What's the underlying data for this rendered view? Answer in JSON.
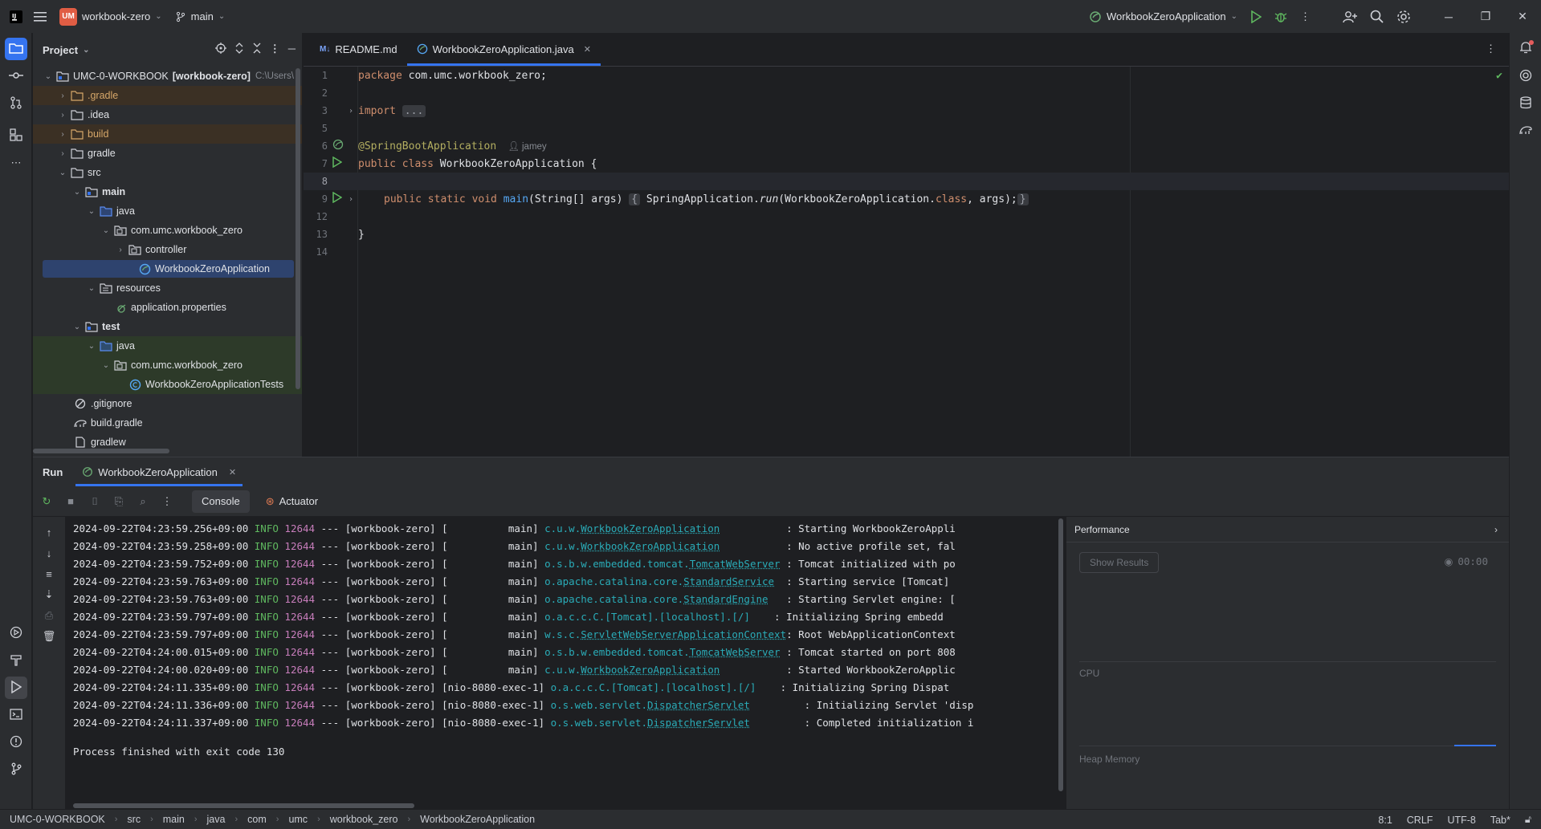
{
  "titlebar": {
    "project_badge": "UM",
    "project_name": "workbook-zero",
    "branch": "main",
    "run_config": "WorkbookZeroApplication"
  },
  "project_panel": {
    "title": "Project",
    "root_name": "UMC-0-WORKBOOK",
    "root_module": "[workbook-zero]",
    "root_path": "C:\\Users\\",
    "items": [
      {
        "label": ".gradle"
      },
      {
        "label": ".idea"
      },
      {
        "label": "build"
      },
      {
        "label": "gradle"
      },
      {
        "label": "src"
      },
      {
        "label": "main"
      },
      {
        "label": "java"
      },
      {
        "label": "com.umc.workbook_zero"
      },
      {
        "label": "controller"
      },
      {
        "label": "WorkbookZeroApplication"
      },
      {
        "label": "resources"
      },
      {
        "label": "application.properties"
      },
      {
        "label": "test"
      },
      {
        "label": "java"
      },
      {
        "label": "com.umc.workbook_zero"
      },
      {
        "label": "WorkbookZeroApplicationTests"
      },
      {
        "label": ".gitignore"
      },
      {
        "label": "build.gradle"
      },
      {
        "label": "gradlew"
      }
    ]
  },
  "editor": {
    "tabs": [
      {
        "label": "README.md",
        "badge": "M↓"
      },
      {
        "label": "WorkbookZeroApplication.java"
      }
    ],
    "line_numbers": [
      "1",
      "2",
      "3",
      "5",
      "6",
      "7",
      "8",
      "9",
      "12",
      "13",
      "14"
    ],
    "code": {
      "package_kw": "package",
      "package_name": " com.umc.workbook_zero;",
      "import_kw": "import",
      "import_fold": "...",
      "annotation": "@SpringBootApplication",
      "author": "jamey",
      "class_decl_kw": "public class",
      "class_name": " WorkbookZeroApplication {",
      "main_kw": "public static void",
      "main_fn": " main",
      "main_params": "(String[] args) ",
      "fold_open": "{",
      "body_pre": " SpringApplication.",
      "body_run": "run",
      "body_args": "(WorkbookZeroApplication.",
      "body_class": "class",
      "body_end": ", args);",
      "fold_close": "}",
      "closing": "}"
    }
  },
  "run_window": {
    "title": "Run",
    "tab_label": "WorkbookZeroApplication",
    "console_tab": "Console",
    "actuator_tab": "Actuator",
    "logs": [
      {
        "ts": "2024-09-22T04:23:59.256+09:00",
        "level": "INFO",
        "pid": "12644",
        "app": "--- [workbook-zero] [",
        "thread": "          main] ",
        "logger_pre": "c.u.w.",
        "logger_link": "WorkbookZeroApplication",
        "pad": "           ",
        "msg": ": Starting WorkbookZeroAppli"
      },
      {
        "ts": "2024-09-22T04:23:59.258+09:00",
        "level": "INFO",
        "pid": "12644",
        "app": "--- [workbook-zero] [",
        "thread": "          main] ",
        "logger_pre": "c.u.w.",
        "logger_link": "WorkbookZeroApplication",
        "pad": "           ",
        "msg": ": No active profile set, fal"
      },
      {
        "ts": "2024-09-22T04:23:59.752+09:00",
        "level": "INFO",
        "pid": "12644",
        "app": "--- [workbook-zero] [",
        "thread": "          main] ",
        "logger_pre": "o.s.b.w.embedded.tomcat.",
        "logger_link": "TomcatWebServer",
        "pad": " ",
        "msg": ": Tomcat initialized with po"
      },
      {
        "ts": "2024-09-22T04:23:59.763+09:00",
        "level": "INFO",
        "pid": "12644",
        "app": "--- [workbook-zero] [",
        "thread": "          main] ",
        "logger_pre": "o.apache.catalina.core.",
        "logger_link": "StandardService",
        "pad": "  ",
        "msg": ": Starting service [Tomcat]"
      },
      {
        "ts": "2024-09-22T04:23:59.763+09:00",
        "level": "INFO",
        "pid": "12644",
        "app": "--- [workbook-zero] [",
        "thread": "          main] ",
        "logger_pre": "o.apache.catalina.core.",
        "logger_link": "StandardEngine",
        "pad": "   ",
        "msg": ": Starting Servlet engine: ["
      },
      {
        "ts": "2024-09-22T04:23:59.797+09:00",
        "level": "INFO",
        "pid": "12644",
        "app": "--- [workbook-zero] [",
        "thread": "          main] ",
        "logger_pre": "o.a.c.c.C.[Tomcat].[localhost].[/]",
        "logger_link": "",
        "pad": "    ",
        "msg": ": Initializing Spring embedd"
      },
      {
        "ts": "2024-09-22T04:23:59.797+09:00",
        "level": "INFO",
        "pid": "12644",
        "app": "--- [workbook-zero] [",
        "thread": "          main] ",
        "logger_pre": "w.s.c.",
        "logger_link": "ServletWebServerApplicationContext",
        "pad": "",
        "msg": ": Root WebApplicationContext"
      },
      {
        "ts": "2024-09-22T04:24:00.015+09:00",
        "level": "INFO",
        "pid": "12644",
        "app": "--- [workbook-zero] [",
        "thread": "          main] ",
        "logger_pre": "o.s.b.w.embedded.tomcat.",
        "logger_link": "TomcatWebServer",
        "pad": " ",
        "msg": ": Tomcat started on port 808"
      },
      {
        "ts": "2024-09-22T04:24:00.020+09:00",
        "level": "INFO",
        "pid": "12644",
        "app": "--- [workbook-zero] [",
        "thread": "          main] ",
        "logger_pre": "c.u.w.",
        "logger_link": "WorkbookZeroApplication",
        "pad": "           ",
        "msg": ": Started WorkbookZeroApplic"
      },
      {
        "ts": "2024-09-22T04:24:11.335+09:00",
        "level": "INFO",
        "pid": "12644",
        "app": "--- [workbook-zero] [",
        "thread": "nio-8080-exec-1] ",
        "logger_pre": "o.a.c.c.C.[Tomcat].[localhost].[/]",
        "logger_link": "",
        "pad": "    ",
        "msg": ": Initializing Spring Dispat"
      },
      {
        "ts": "2024-09-22T04:24:11.336+09:00",
        "level": "INFO",
        "pid": "12644",
        "app": "--- [workbook-zero] [",
        "thread": "nio-8080-exec-1] ",
        "logger_pre": "o.s.web.servlet.",
        "logger_link": "DispatcherServlet",
        "pad": "         ",
        "msg": ": Initializing Servlet 'disp"
      },
      {
        "ts": "2024-09-22T04:24:11.337+09:00",
        "level": "INFO",
        "pid": "12644",
        "app": "--- [workbook-zero] [",
        "thread": "nio-8080-exec-1] ",
        "logger_pre": "o.s.web.servlet.",
        "logger_link": "DispatcherServlet",
        "pad": "         ",
        "msg": ": Completed initialization i"
      }
    ],
    "exit_message": "Process finished with exit code 130",
    "performance": {
      "title": "Performance",
      "show_results": "Show Results",
      "timer": "00:00",
      "cpu_label": "CPU",
      "heap_label": "Heap Memory"
    }
  },
  "statusbar": {
    "breadcrumbs": [
      "UMC-0-WORKBOOK",
      "src",
      "main",
      "java",
      "com",
      "umc",
      "workbook_zero",
      "WorkbookZeroApplication"
    ],
    "position": "8:1",
    "line_ending": "CRLF",
    "encoding": "UTF-8",
    "indent": "Tab*"
  }
}
